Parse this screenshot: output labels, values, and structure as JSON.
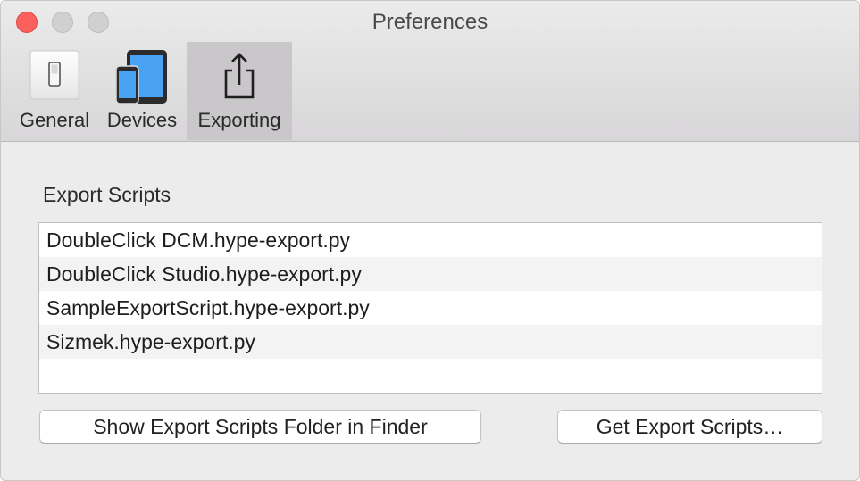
{
  "window": {
    "title": "Preferences"
  },
  "toolbar": {
    "tabs": [
      {
        "label": "General",
        "icon": "switch-icon"
      },
      {
        "label": "Devices",
        "icon": "devices-icon"
      },
      {
        "label": "Exporting",
        "icon": "share-icon",
        "selected": true
      }
    ]
  },
  "export_scripts": {
    "title": "Export Scripts",
    "items": [
      "DoubleClick DCM.hype-export.py",
      "DoubleClick Studio.hype-export.py",
      "SampleExportScript.hype-export.py",
      "Sizmek.hype-export.py"
    ],
    "show_folder_button": "Show Export Scripts Folder in Finder",
    "get_scripts_button": "Get Export Scripts…"
  },
  "colors": {
    "close": "#fc605c",
    "selected_tab": "#c9c7c9",
    "device_screen": "#4aa2f4"
  }
}
